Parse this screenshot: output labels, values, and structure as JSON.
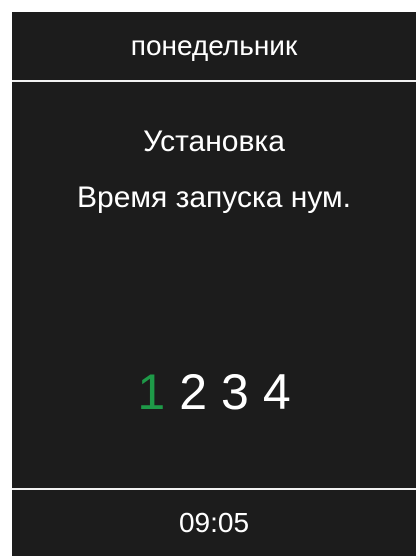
{
  "header": {
    "day": "понедельник"
  },
  "content": {
    "line1": "Установка",
    "line2": "Время запуска нум."
  },
  "selector": {
    "numbers": [
      "1",
      "2",
      "3",
      "4"
    ],
    "active_index": 0,
    "active_color": "#1e9a48"
  },
  "footer": {
    "time": "09:05"
  }
}
